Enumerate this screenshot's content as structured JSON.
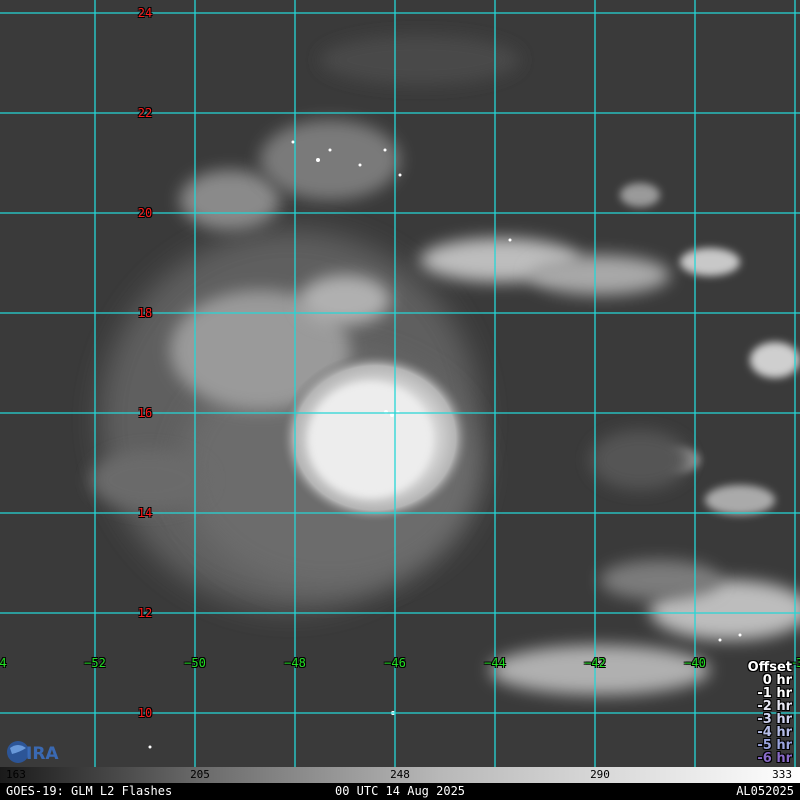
{
  "lat_labels": [
    "24",
    "22",
    "20",
    "18",
    "16",
    "14",
    "12",
    "10"
  ],
  "lon_labels": [
    "4",
    "−52",
    "−50",
    "−48",
    "−46",
    "−44",
    "−42",
    "−40",
    "−3"
  ],
  "offset_legend": {
    "title": "Offset",
    "items": [
      {
        "label": "0 hr",
        "color": "#ffffff"
      },
      {
        "label": "-1 hr",
        "color": "#ffffff"
      },
      {
        "label": "-2 hr",
        "color": "#e8e8f4"
      },
      {
        "label": "-3 hr",
        "color": "#cfd3f0"
      },
      {
        "label": "-4 hr",
        "color": "#b5bde8"
      },
      {
        "label": "-5 hr",
        "color": "#9aa4de"
      },
      {
        "label": "-6 hr",
        "color": "#8a6bc9"
      }
    ]
  },
  "colorbar_ticks": [
    "163",
    "205",
    "248",
    "290",
    "333"
  ],
  "footer": {
    "left": "GOES-19: GLM L2 Flashes",
    "center": "00 UTC 14 Aug 2025",
    "right": "AL052025"
  },
  "logo_text": "CIRA",
  "colors": {
    "gridline": "#25d6d6",
    "lat_label": "#ff1a1a",
    "lon_label": "#22e022",
    "background": "#3a3a3a"
  }
}
